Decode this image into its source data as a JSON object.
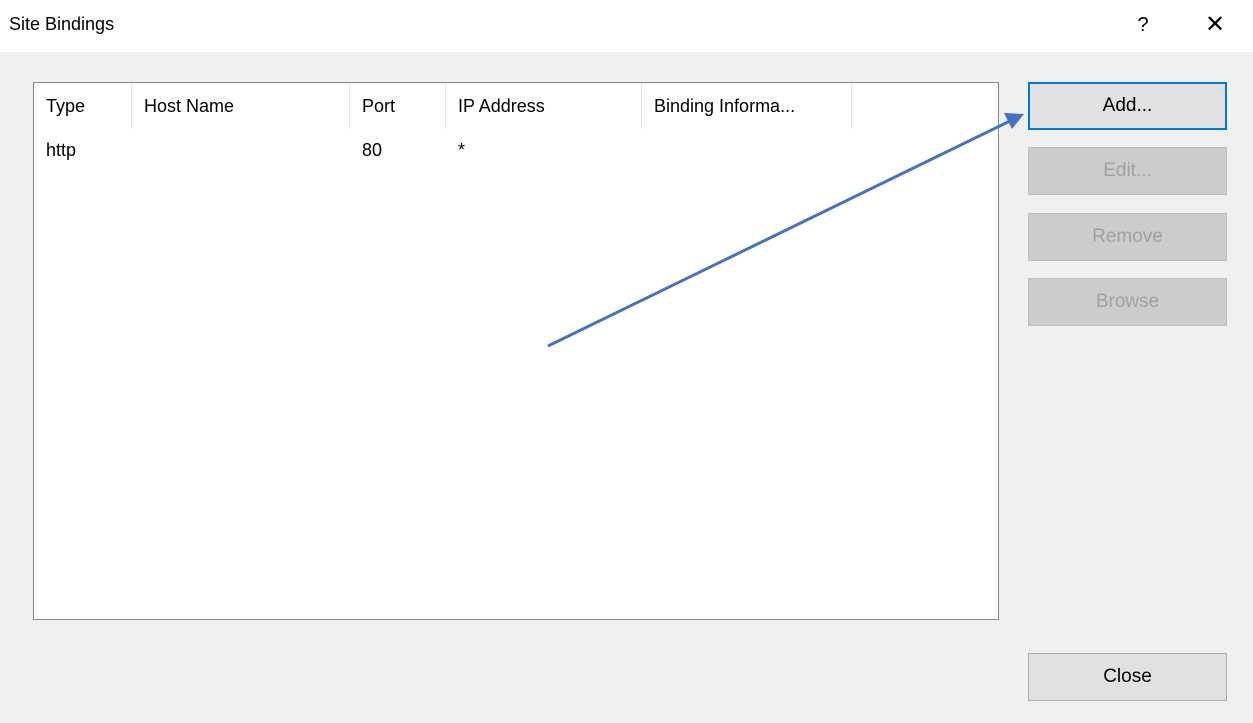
{
  "window": {
    "title": "Site Bindings",
    "help_label": "?",
    "close_label": "✕"
  },
  "list": {
    "columns": [
      "Type",
      "Host Name",
      "Port",
      "IP Address",
      "Binding Informa..."
    ],
    "rows": [
      {
        "type": "http",
        "host_name": "",
        "port": "80",
        "ip_address": "*",
        "binding_information": ""
      }
    ]
  },
  "buttons": {
    "add": "Add...",
    "edit": "Edit...",
    "remove": "Remove",
    "browse": "Browse",
    "close": "Close"
  },
  "annotation": {
    "arrow_color": "#4472c4"
  }
}
